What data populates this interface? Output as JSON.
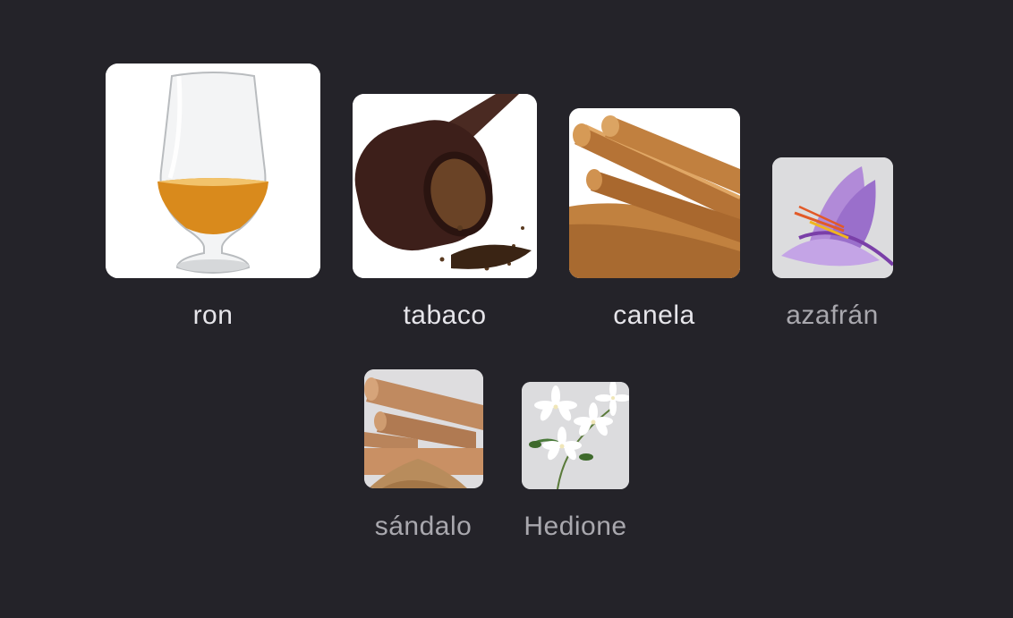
{
  "notes": [
    {
      "label": "ron",
      "icon": "rum-glass-icon"
    },
    {
      "label": "tabaco",
      "icon": "tobacco-pipe-icon"
    },
    {
      "label": "canela",
      "icon": "cinnamon-icon"
    },
    {
      "label": "azafrán",
      "icon": "saffron-flower-icon"
    },
    {
      "label": "sándalo",
      "icon": "sandalwood-icon"
    },
    {
      "label": "Hedione",
      "icon": "jasmine-icon"
    }
  ],
  "colors": {
    "background": "#242329",
    "label_primary": "#e6e5ea",
    "label_secondary": "#a9a8ae"
  }
}
